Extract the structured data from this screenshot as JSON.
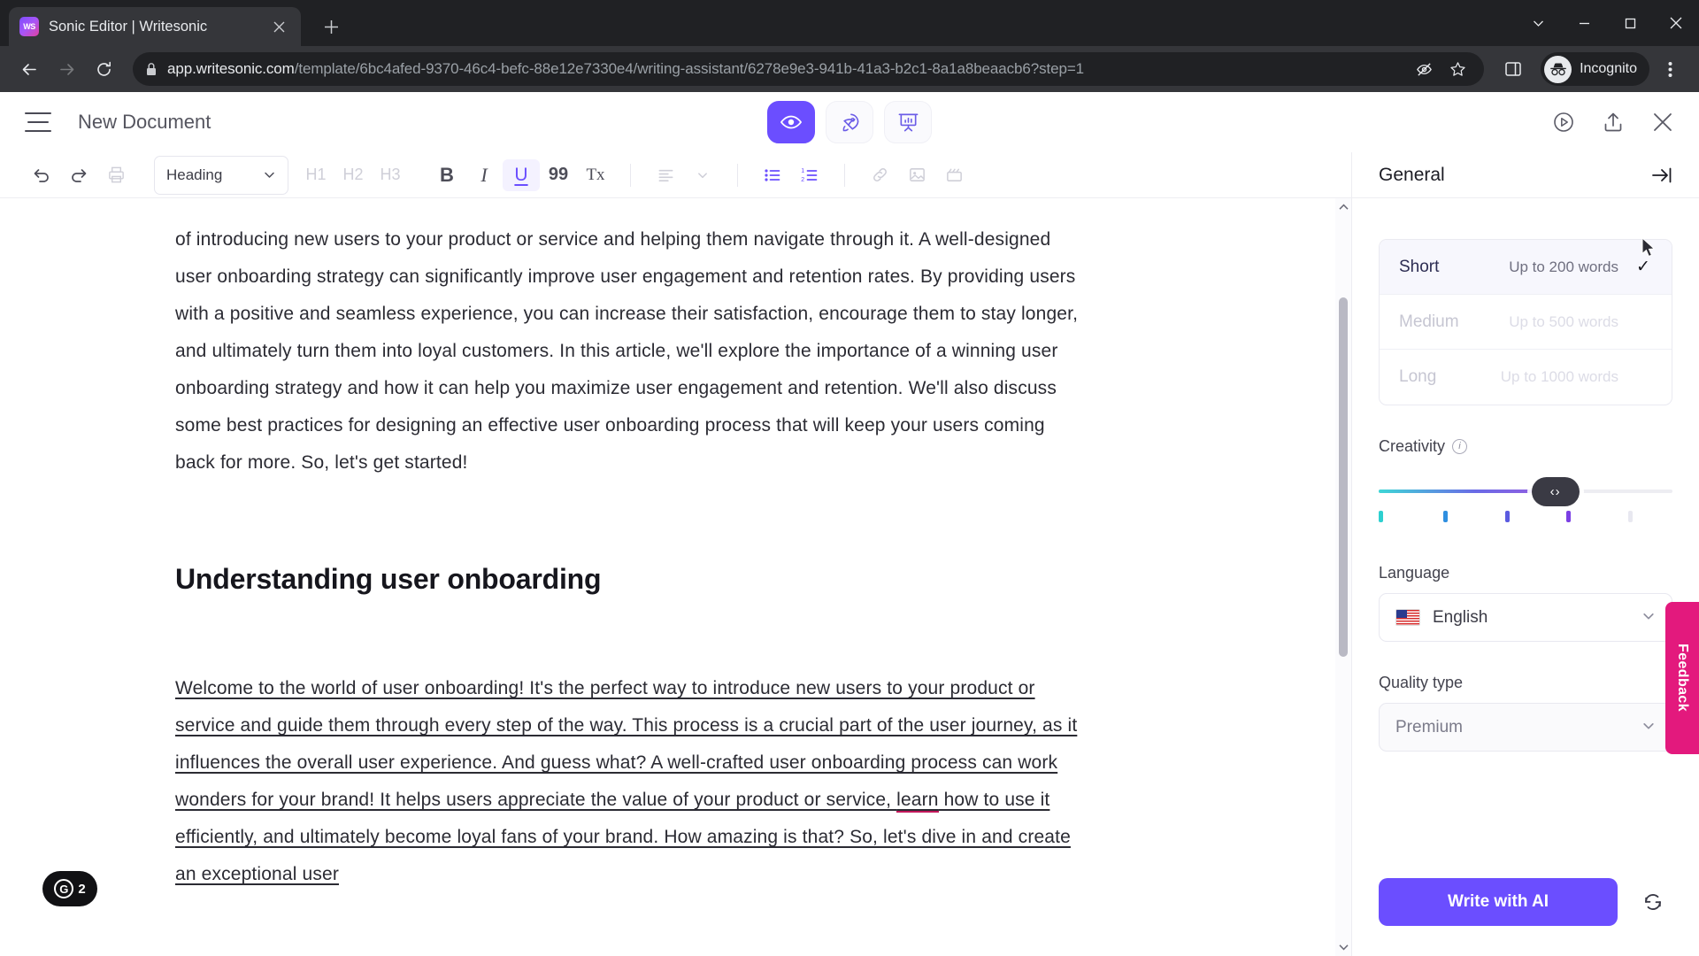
{
  "browser": {
    "tab": {
      "title": "Sonic Editor | Writesonic",
      "favicon_label": "WS",
      "close_icon": "close-icon"
    },
    "new_tab_label": "+",
    "window_controls": [
      "minimize-chevron",
      "minimize",
      "maximize",
      "close"
    ],
    "nav": {
      "back": "back-arrow-icon",
      "forward": "forward-arrow-icon",
      "reload": "reload-icon"
    },
    "url": {
      "domain": "app.writesonic.com",
      "path": "/template/6bc4afed-9370-46c4-befc-88e12e7330e4/writing-assistant/6278e9e3-941b-41a3-b2c1-8a1a8beaacb6?step=1",
      "lock_icon": "lock-icon"
    },
    "omni_icons": [
      "eye-off-icon",
      "star-icon",
      "side-panel-icon"
    ],
    "profile": {
      "label": "Incognito",
      "icon": "incognito-icon"
    },
    "menu_icon": "three-dot-menu-icon"
  },
  "app": {
    "header": {
      "menu_icon": "hamburger-menu-icon",
      "document_title": "New Document",
      "modes": [
        {
          "name": "preview",
          "icon": "eye-icon",
          "active": true
        },
        {
          "name": "boost",
          "icon": "rocket-icon",
          "active": false
        },
        {
          "name": "presentation",
          "icon": "presentation-chart-icon",
          "active": false
        }
      ],
      "right_icons": [
        {
          "name": "history-icon"
        },
        {
          "name": "share-icon"
        },
        {
          "name": "close-icon"
        }
      ]
    },
    "toolbar": {
      "undo": "undo-icon",
      "redo": "redo-icon",
      "print": "print-icon",
      "block_style": "Heading",
      "headings": [
        "H1",
        "H2",
        "H3"
      ],
      "bold": "B",
      "italic": "I",
      "underline": "U",
      "quote": "99",
      "clear_format": "Tx",
      "align": "align-left-icon",
      "align_chevron": "chevron-down-icon",
      "bullet_list": "bullet-list-icon",
      "numbered_list": "numbered-list-icon",
      "link": "link-icon",
      "image": "image-icon",
      "video": "video-icon"
    },
    "document": {
      "paragraph_1": "of introducing new users to your product or service and helping them navigate through it. A well-designed user onboarding strategy can significantly improve user engagement and retention rates. By providing users with a positive and seamless experience, you can increase their satisfaction, encourage them to stay longer, and ultimately turn them into loyal customers. In this article, we'll explore the importance of a winning user onboarding strategy and how it can help you maximize user engagement and retention. We'll also discuss some best practices for designing an effective user onboarding process that will keep your users coming back for more. So, let's get started!",
      "heading_2": "Understanding user onboarding",
      "paragraph_2_part1": "Welcome to the world of user onboarding! It's the perfect way to introduce new users to your product or service and guide them through every step of the way. This process is a crucial part of the user journey, as it influences the overall user experience. And guess what? A well-crafted user onboarding process can work wonders for your brand! It helps users appreciate the value of your product or service, ",
      "paragraph_2_misspelled": "learn",
      "paragraph_2_part2": " how to use it efficiently, and ultimately become loyal fans of your brand. How amazing is that? So, let's dive in and create an exceptional user"
    },
    "grammarly": {
      "logo": "grammarly-icon",
      "count": "2"
    },
    "scrollbar": {
      "up_arrow": "chevron-up-icon",
      "down_arrow": "chevron-down-icon"
    }
  },
  "panel": {
    "title": "General",
    "collapse_icon": "collapse-panel-icon",
    "length_options": [
      {
        "label": "Short",
        "words": "Up to 200 words",
        "selected": true,
        "disabled": false
      },
      {
        "label": "Medium",
        "words": "Up to 500 words",
        "selected": false,
        "disabled": true
      },
      {
        "label": "Long",
        "words": "Up to 1000 words",
        "selected": false,
        "disabled": true
      }
    ],
    "check_glyph": "✓",
    "creativity": {
      "label": "Creativity",
      "info_icon": "info-icon",
      "handle_glyph": "‹›",
      "value_percent": 60,
      "tick_colors": [
        "#2ed0d0",
        "#2f8fe0",
        "#5b5be0",
        "#7b3fe4",
        "#e8e8f0"
      ]
    },
    "language": {
      "label": "Language",
      "value": "English",
      "flag": "us-flag-icon",
      "chevron": "chevron-down-icon"
    },
    "quality": {
      "label": "Quality type",
      "value": "Premium",
      "chevron": "chevron-down-icon"
    },
    "write_button": "Write with AI",
    "refresh_icon": "refresh-icon",
    "feedback_tab": "Feedback",
    "accent_color": "#6b4eff",
    "feedback_color": "#e3197d"
  }
}
